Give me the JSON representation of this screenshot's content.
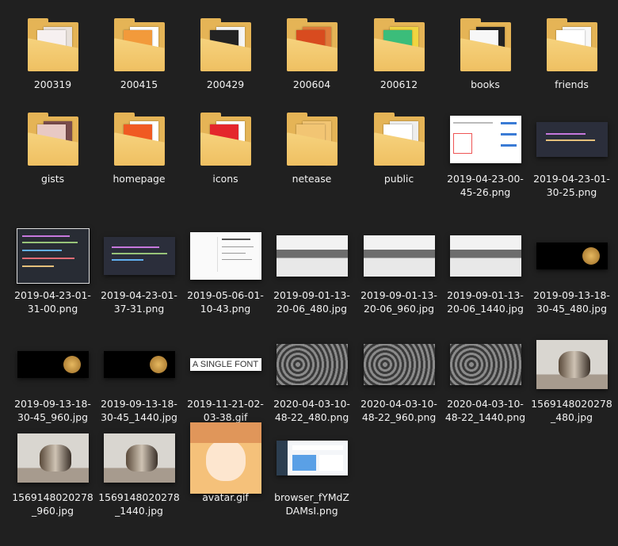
{
  "items": [
    {
      "name": "200319",
      "type": "folder",
      "doc": "#f6f0f0",
      "doc2": "#e8e1db"
    },
    {
      "name": "200415",
      "type": "folder",
      "doc": "#f29a3b",
      "doc2": "#ffffff"
    },
    {
      "name": "200429",
      "type": "folder",
      "doc": "#222222",
      "doc2": "#f5f5f5"
    },
    {
      "name": "200604",
      "type": "folder",
      "doc": "#d84b1f",
      "doc2": "#e07a3a"
    },
    {
      "name": "200612",
      "type": "folder",
      "doc": "#3bbd7a",
      "doc2": "#f0d540"
    },
    {
      "name": "books",
      "type": "folder",
      "doc": "#f7f7f7",
      "doc2": "#222222"
    },
    {
      "name": "friends",
      "type": "folder",
      "doc": "#ffffff",
      "doc2": "#f7f7f7"
    },
    {
      "name": "gists",
      "type": "folder",
      "doc": "#e8c9c4",
      "doc2": "#7a4c4c"
    },
    {
      "name": "homepage",
      "type": "folder",
      "doc": "#f05a22",
      "doc2": "#ffffff"
    },
    {
      "name": "icons",
      "type": "folder",
      "doc": "#e4262c",
      "doc2": "#ffffff"
    },
    {
      "name": "netease",
      "type": "folder",
      "doc": "#f2c573",
      "doc2": "#f2c573"
    },
    {
      "name": "public",
      "type": "folder",
      "doc": "#ffffff",
      "doc2": "#eeeeee"
    },
    {
      "name": "2019-04-23-00-\n45-26.png",
      "type": "image",
      "img": "doc"
    },
    {
      "name": "2019-04-23-01-\n30-25.png",
      "type": "image",
      "img": "code-small"
    },
    {
      "name": "2019-04-23-01-\n31-00.png",
      "type": "image",
      "img": "code-big"
    },
    {
      "name": "2019-04-23-01-\n37-31.png",
      "type": "image",
      "img": "code-wide"
    },
    {
      "name": "2019-05-06-01-\n10-43.png",
      "type": "image",
      "img": "page"
    },
    {
      "name": "2019-09-01-13-\n20-06_480.jpg",
      "type": "image",
      "img": "snow"
    },
    {
      "name": "2019-09-01-13-\n20-06_960.jpg",
      "type": "image",
      "img": "snow"
    },
    {
      "name": "2019-09-01-13-\n20-06_1440.jpg",
      "type": "image",
      "img": "snow"
    },
    {
      "name": "2019-09-13-18-\n30-45_480.jpg",
      "type": "image",
      "img": "moon"
    },
    {
      "name": "2019-09-13-18-\n30-45_960.jpg",
      "type": "image",
      "img": "moon"
    },
    {
      "name": "2019-09-13-18-\n30-45_1440.jpg",
      "type": "image",
      "img": "moon"
    },
    {
      "name": "2019-11-21-02-\n03-38.gif",
      "type": "image",
      "img": "font",
      "text": "A SINGLE FONT"
    },
    {
      "name": "2020-04-03-10-\n48-22_480.png",
      "type": "image",
      "img": "swirl"
    },
    {
      "name": "2020-04-03-10-\n48-22_960.png",
      "type": "image",
      "img": "swirl"
    },
    {
      "name": "2020-04-03-10-\n48-22_1440.png",
      "type": "image",
      "img": "swirl"
    },
    {
      "name": "1569148020278\n_480.jpg",
      "type": "image",
      "img": "cat"
    },
    {
      "name": "1569148020278\n_960.jpg",
      "type": "image",
      "img": "cat"
    },
    {
      "name": "1569148020278\n_1440.jpg",
      "type": "image",
      "img": "cat"
    },
    {
      "name": "avatar.gif",
      "type": "image",
      "img": "avatar"
    },
    {
      "name": "browser_fYMdZ\nDAMsI.png",
      "type": "image",
      "img": "dashboard"
    }
  ]
}
